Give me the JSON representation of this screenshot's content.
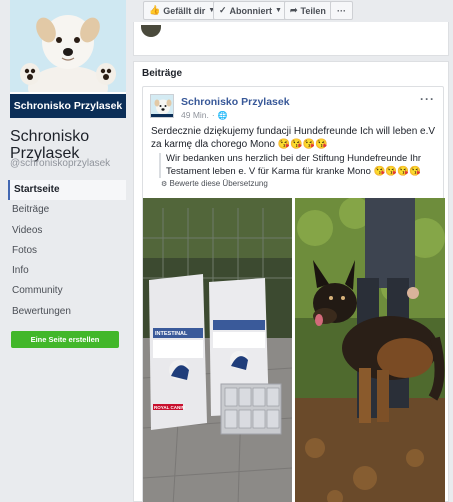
{
  "sidebar": {
    "banner_name": "Schronisko Przylasek",
    "page_name": "Schronisko Przylasek",
    "handle": "@schroniskoprzylasek",
    "nav": [
      "Startseite",
      "Beiträge",
      "Videos",
      "Fotos",
      "Info",
      "Community",
      "Bewertungen"
    ],
    "create_page": "Eine Seite erstellen"
  },
  "actions": {
    "like": "Gefällt dir",
    "follow": "Abonniert",
    "share": "Teilen",
    "more": "···"
  },
  "feed": {
    "heading": "Beiträge",
    "post": {
      "author": "Schronisko Przylasek",
      "time": "49 Min.",
      "text": "Serdecznie dziękujemy fundacji Hundefreunde Ich will leben e.V za karmę dla chorego Mono 😘😘😘😘",
      "translation": "Wir bedanken uns herzlich bei der Stiftung Hundefreunde Ihr Testament leben e. V für Karma für kranke Mono 😘😘😘😘",
      "rate_translation": "Bewerte diese Übersetzung",
      "more": "···"
    },
    "photo_left": {
      "bag_label": "INTESTINAL",
      "bag_brand": "ROYAL CANIN"
    }
  },
  "colors": {
    "fb_blue": "#4267b2",
    "link_blue": "#385898",
    "banner_navy": "#0b2e57",
    "create_green": "#42b72a"
  },
  "icons": [
    "thumbs-up-icon",
    "check-icon",
    "share-arrow-icon",
    "globe-icon",
    "more-dots-icon"
  ]
}
